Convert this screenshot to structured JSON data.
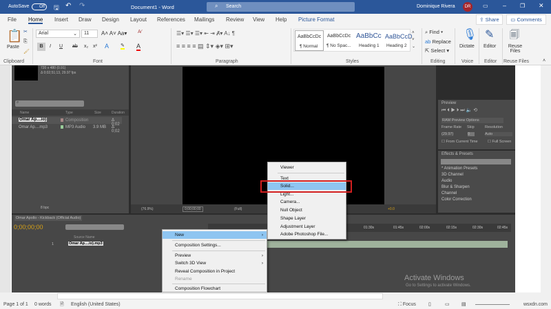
{
  "titlebar": {
    "autosave_label": "AutoSave",
    "autosave_state": "Off",
    "doc_title": "Document1 - Word",
    "search_placeholder": "Search",
    "user_name": "Dominique Rivera",
    "user_initials": "DR"
  },
  "tabs": [
    "File",
    "Home",
    "Insert",
    "Draw",
    "Design",
    "Layout",
    "References",
    "Mailings",
    "Review",
    "View",
    "Help",
    "Picture Format"
  ],
  "share_label": "Share",
  "comments_label": "Comments",
  "ribbon": {
    "paste_label": "Paste",
    "clipboard_label": "Clipboard",
    "font_name": "Arial",
    "font_size": "11",
    "font_label": "Font",
    "paragraph_label": "Paragraph",
    "styles": [
      {
        "preview": "AaBbCcDc",
        "name": "¶ Normal"
      },
      {
        "preview": "AaBbCcDc",
        "name": "¶ No Spac..."
      },
      {
        "preview": "AaBbCc",
        "name": "Heading 1"
      },
      {
        "preview": "AaBbCcD",
        "name": "Heading 2"
      }
    ],
    "styles_label": "Styles",
    "find_label": "Find",
    "replace_label": "Replace",
    "select_label": "Select",
    "editing_label": "Editing",
    "dictate_label": "Dictate",
    "voice_label": "Voice",
    "editor_label": "Editor",
    "editor_group_label": "Editor",
    "reuse_label": "Reuse Files",
    "reuse_group_label": "Reuse Files"
  },
  "ae": {
    "project": {
      "info_line1": "720 x 480 (0.91)",
      "info_line2": "Δ 0;02;51;13, 29.97 fps",
      "columns": [
        "Name",
        "Type",
        "Size",
        "Duration"
      ],
      "items": [
        {
          "name": "Omar Ap....io)",
          "type": "Composition",
          "size": "",
          "duration": "Δ 0;02"
        },
        {
          "name": "Omar Ap....mp3",
          "type": "MP3 Audio",
          "size": "3.9 MB",
          "duration": "Δ 0;02"
        }
      ],
      "bpc": "8 bpc"
    },
    "viewer": {
      "zoom": "(76.9%)",
      "timecode": "0;00;00;00",
      "resolution": "(Full)",
      "exposure": "+0.0"
    },
    "preview": {
      "title": "Preview",
      "ram_options": "RAM Preview Options",
      "frame_rate_label": "Frame Rate",
      "skip_label": "Skip",
      "resolution_label": "Resolution",
      "frame_rate": "(29.97)",
      "skip": "0",
      "resolution": "Auto",
      "from_current": "From Current Time",
      "full_screen": "Full Screen"
    },
    "effects": {
      "title": "Effects & Presets",
      "items": [
        "* Animation Presets",
        "3D Channel",
        "Audio",
        "Blur & Sharpen",
        "Channel",
        "Color Correction"
      ]
    },
    "timeline": {
      "tab": "Omar Apollo - Kickback (Official Audio)",
      "timecode": "0;00;00;00",
      "source_name_label": "Source Name",
      "layer_index": "1",
      "layer_name": "Omar Ap....io).mp3",
      "ruler": [
        "01:30s",
        "01:45s",
        "02:00s",
        "02:15s",
        "02:30s",
        "02:45s"
      ]
    },
    "context_menu": [
      {
        "label": "New",
        "submenu": true,
        "highlight": true
      },
      {
        "label": "Composition Settings..."
      },
      {
        "label": "Preview",
        "submenu": true
      },
      {
        "label": "Switch 3D View",
        "submenu": true
      },
      {
        "label": "Reveal Composition in Project"
      },
      {
        "label": "Rename",
        "disabled": true
      },
      {
        "label": "Composition Flowchart"
      }
    ],
    "submenu": [
      "Viewer",
      "Text",
      "Solid...",
      "Light...",
      "Camera...",
      "Null Object",
      "Shape Layer",
      "Adjustment Layer",
      "Adobe Photoshop File..."
    ],
    "watermark_title": "Activate Windows",
    "watermark_sub": "Go to Settings to activate Windows."
  },
  "status": {
    "page": "Page 1 of 1",
    "words": "0 words",
    "language": "English (United States)",
    "focus": "Focus",
    "zoom": "wsxdn.com"
  },
  "colors": {
    "word_blue": "#2b579a",
    "highlight": "#8ec5f1",
    "red_box": "#d21f1f"
  }
}
